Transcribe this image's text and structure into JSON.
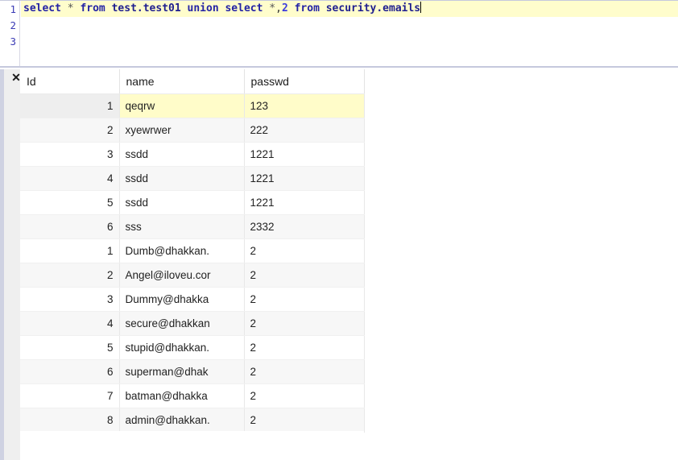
{
  "editor": {
    "line_numbers": [
      "1",
      "2",
      "3"
    ],
    "query_full": "select * from test.test01 union select *,2 from security.emails",
    "tokens": {
      "kw_select1": "select",
      "star1": "*",
      "kw_from1": "from",
      "table1": "test.test01",
      "kw_union": "union",
      "kw_select2": "select",
      "star2": "*",
      "comma": ",",
      "num2": "2",
      "kw_from2": "from",
      "table2": "security.emails"
    },
    "line2_text": "",
    "line3_text": "",
    "current_line_bg": "#fffdcc",
    "keyword_color": "#2323a5",
    "number_color": "#3b3bdd",
    "gutter_number_color": "#3b3bb5"
  },
  "result_panel": {
    "close_label": "×",
    "close_icon_glyph": "✕",
    "highlight_color": "#fffcc9",
    "columns": [
      "Id",
      "name",
      "passwd"
    ],
    "rows": [
      {
        "id": "1",
        "name": "qeqrw",
        "passwd": "123",
        "selected": true
      },
      {
        "id": "2",
        "name": "xyewrwer",
        "passwd": "222",
        "selected": false
      },
      {
        "id": "3",
        "name": "ssdd",
        "passwd": "1221",
        "selected": false
      },
      {
        "id": "4",
        "name": "ssdd",
        "passwd": "1221",
        "selected": false
      },
      {
        "id": "5",
        "name": "ssdd",
        "passwd": "1221",
        "selected": false
      },
      {
        "id": "6",
        "name": "sss",
        "passwd": "2332",
        "selected": false
      },
      {
        "id": "1",
        "name": "Dumb@dhakkan.",
        "passwd": "2",
        "selected": false
      },
      {
        "id": "2",
        "name": "Angel@iloveu.cor",
        "passwd": "2",
        "selected": false
      },
      {
        "id": "3",
        "name": "Dummy@dhakka",
        "passwd": "2",
        "selected": false
      },
      {
        "id": "4",
        "name": "secure@dhakkan",
        "passwd": "2",
        "selected": false
      },
      {
        "id": "5",
        "name": "stupid@dhakkan.",
        "passwd": "2",
        "selected": false
      },
      {
        "id": "6",
        "name": "superman@dhak",
        "passwd": "2",
        "selected": false
      },
      {
        "id": "7",
        "name": "batman@dhakka",
        "passwd": "2",
        "selected": false
      },
      {
        "id": "8",
        "name": "admin@dhakkan.",
        "passwd": "2",
        "selected": false
      }
    ]
  }
}
